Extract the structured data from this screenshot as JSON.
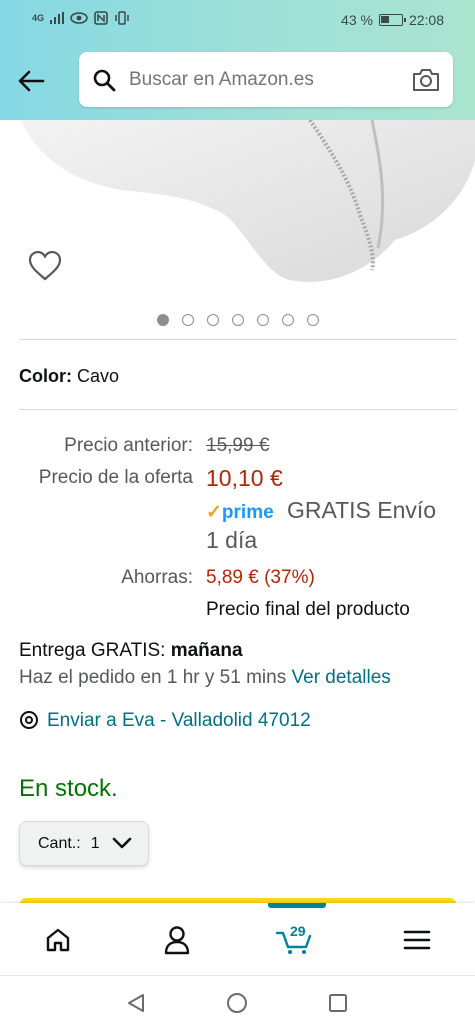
{
  "status_bar": {
    "network": "4G",
    "battery_percent": "43 %",
    "time": "22:08"
  },
  "header": {
    "search_placeholder": "Buscar en Amazon.es"
  },
  "gallery": {
    "image_count": 7,
    "active_index": 0
  },
  "product": {
    "color_label": "Color:",
    "color_value": "Cavo",
    "previous_price_label": "Precio anterior:",
    "previous_price": "15,99 €",
    "deal_price_label": "Precio de la oferta",
    "deal_price": "10,10 €",
    "prime_check": "✓",
    "prime_label": "prime",
    "free_shipping_line1": "GRATIS Envío",
    "free_shipping_line2": "1 día",
    "savings_label": "Ahorras:",
    "savings_value": "5,89 € (37%)",
    "final_price_note": "Precio final del producto"
  },
  "delivery": {
    "prefix": "Entrega GRATIS:",
    "day": "mañana",
    "order_text": "Haz el pedido en 1 hr y 51 mins",
    "details_link": "Ver detalles",
    "ship_to": "Enviar a Eva - Valladolid 47012"
  },
  "availability": {
    "stock": "En stock.",
    "qty_label": "Cant.:",
    "qty_value": "1"
  },
  "bottom_nav": {
    "cart_count": "29"
  },
  "colors": {
    "header_gradient_start": "#84d8e3",
    "link": "#007185",
    "price_red": "#b12704",
    "stock_green": "#007600",
    "prime_blue": "#1a98ff",
    "cart_teal": "#008296"
  }
}
